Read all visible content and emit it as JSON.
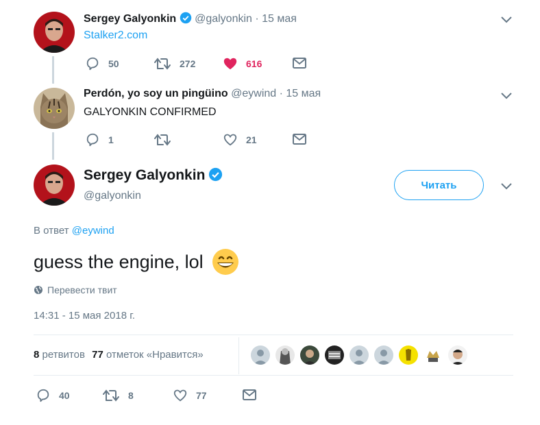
{
  "tweet1": {
    "name": "Sergey Galyonkin",
    "handle": "@galyonkin",
    "date": "· 15 мая",
    "text": "Stalker2.com",
    "replies": "50",
    "retweets": "272",
    "likes": "616",
    "liked": true
  },
  "tweet2": {
    "name": "Perdón, yo soy un pingüino",
    "handle": "@eywind",
    "date": "· 15 мая",
    "text": "GALYONKIN CONFIRMED",
    "replies": "1",
    "retweets": "",
    "likes": "21"
  },
  "main": {
    "name": "Sergey Galyonkin",
    "handle": "@galyonkin",
    "follow_label": "Читать",
    "reply_prefix": "В ответ",
    "reply_to": "@eywind",
    "text": "guess the engine, lol",
    "emoji": "grinning-face-emoji",
    "translate": "Перевести твит",
    "timestamp": "14:31 - 15 мая 2018 г.",
    "retweets_count": "8",
    "retweets_label": "ретвитов",
    "likes_count": "77",
    "likes_label": "отметок «Нравится»",
    "replies": "40",
    "retweets": "8",
    "likes": "77"
  },
  "colors": {
    "accent": "#1da1f2",
    "like": "#e0245e",
    "muted": "#657786"
  }
}
